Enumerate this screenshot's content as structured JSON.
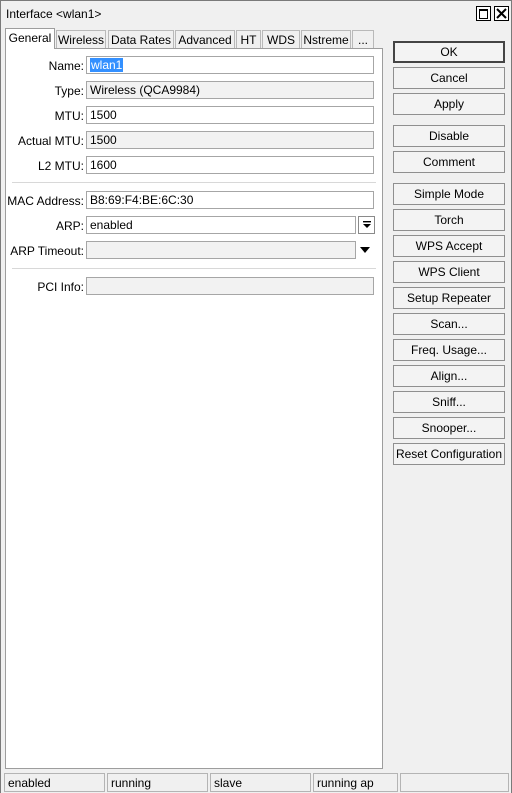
{
  "window": {
    "title": "Interface <wlan1>"
  },
  "tabs": [
    {
      "label": "General",
      "active": true
    },
    {
      "label": "Wireless"
    },
    {
      "label": "Data Rates"
    },
    {
      "label": "Advanced"
    },
    {
      "label": "HT"
    },
    {
      "label": "WDS"
    },
    {
      "label": "Nstreme"
    },
    {
      "label": "..."
    }
  ],
  "general": {
    "name": {
      "label": "Name:",
      "value": "wlan1"
    },
    "type": {
      "label": "Type:",
      "value": "Wireless (QCA9984)"
    },
    "mtu": {
      "label": "MTU:",
      "value": "1500"
    },
    "actual_mtu": {
      "label": "Actual MTU:",
      "value": "1500"
    },
    "l2_mtu": {
      "label": "L2 MTU:",
      "value": "1600"
    },
    "mac_address": {
      "label": "MAC Address:",
      "value": "B8:69:F4:BE:6C:30"
    },
    "arp": {
      "label": "ARP:",
      "value": "enabled"
    },
    "arp_timeout": {
      "label": "ARP Timeout:",
      "value": ""
    },
    "pci_info": {
      "label": "PCI Info:",
      "value": ""
    }
  },
  "buttons": {
    "ok": "OK",
    "cancel": "Cancel",
    "apply": "Apply",
    "disable": "Disable",
    "comment": "Comment",
    "simple_mode": "Simple Mode",
    "torch": "Torch",
    "wps_accept": "WPS Accept",
    "wps_client": "WPS Client",
    "setup_repeater": "Setup Repeater",
    "scan": "Scan...",
    "freq_usage": "Freq. Usage...",
    "align": "Align...",
    "sniff": "Sniff...",
    "snooper": "Snooper...",
    "reset_configuration": "Reset Configuration"
  },
  "status_bar": [
    "enabled",
    "running",
    "slave",
    "running ap",
    ""
  ]
}
